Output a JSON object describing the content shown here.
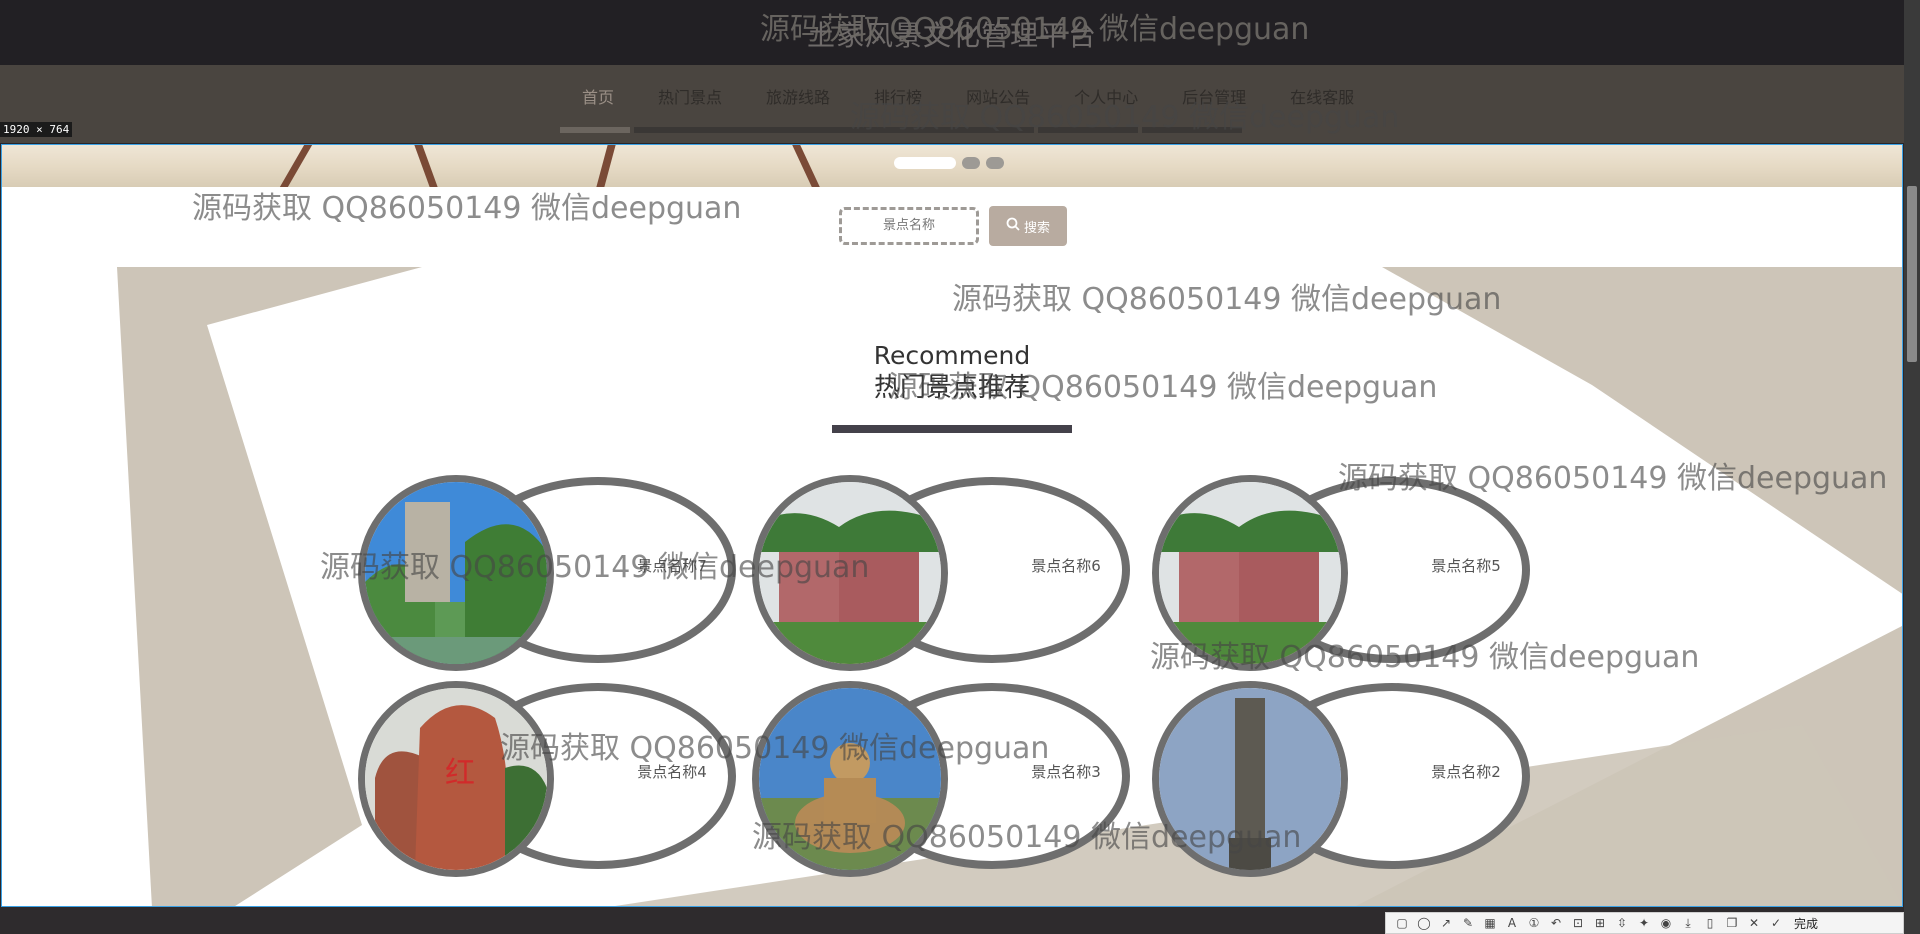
{
  "header": {
    "title": "土家风景文化管理平台"
  },
  "nav": {
    "items": [
      {
        "label": "首页",
        "active": true
      },
      {
        "label": "热门景点"
      },
      {
        "label": "旅游线路"
      },
      {
        "label": "排行榜"
      },
      {
        "label": "网站公告"
      },
      {
        "label": "个人中心"
      },
      {
        "label": "后台管理"
      },
      {
        "label": "在线客服"
      }
    ]
  },
  "capture": {
    "size_label": "1920 × 764"
  },
  "search": {
    "placeholder": "景点名称",
    "button_label": "搜索"
  },
  "section": {
    "title_en": "Recommend",
    "title_zh": "热门景点推荐"
  },
  "spots": [
    {
      "name": "景点名称7",
      "image": "karst-cliff-river"
    },
    {
      "name": "景点名称6",
      "image": "red-rock-cliffs"
    },
    {
      "name": "景点名称5",
      "image": "red-rock-cliffs"
    },
    {
      "name": "景点名称4",
      "image": "red-carved-stone"
    },
    {
      "name": "景点名称3",
      "image": "golden-buddha"
    },
    {
      "name": "景点名称2",
      "image": "stone-pillar"
    }
  ],
  "watermark": {
    "text": "源码获取 QQ86050149 微信deepguan"
  },
  "toolbar": {
    "done_label": "完成"
  },
  "colors": {
    "accent": "#b8aba0",
    "ring": "#6e6e6e",
    "shape": "#cdc5b8",
    "selection": "#3aa1e6"
  }
}
